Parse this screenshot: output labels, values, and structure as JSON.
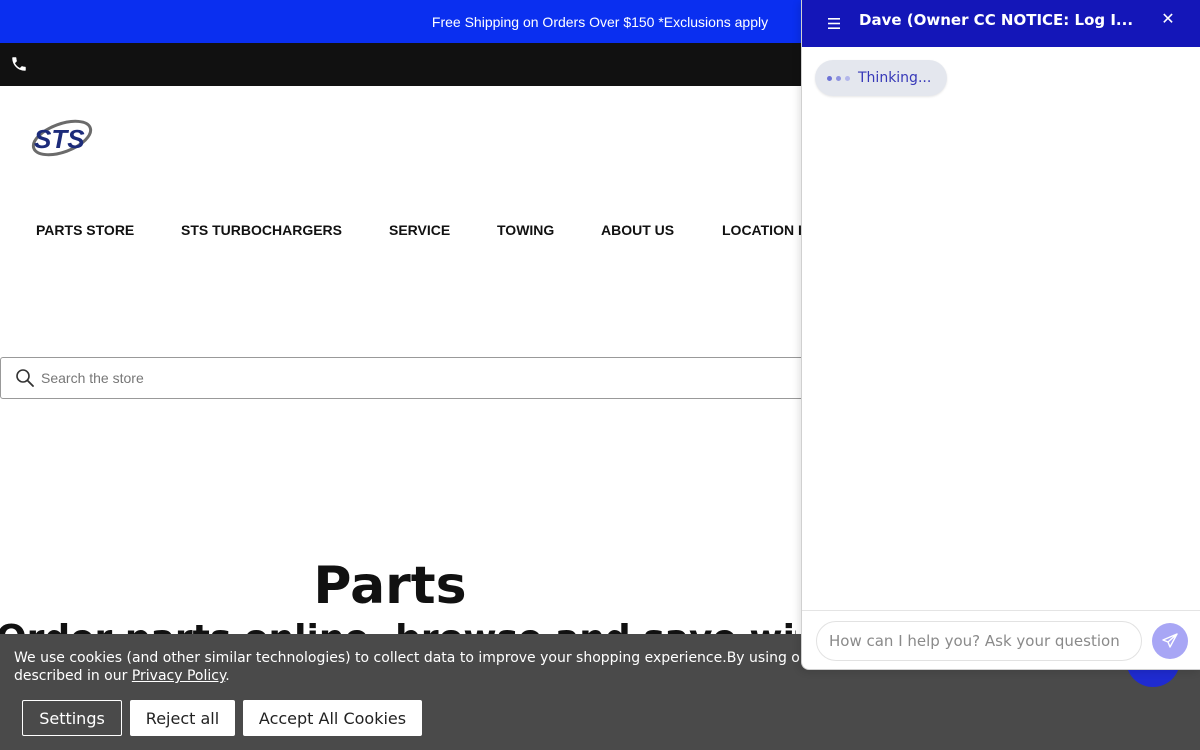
{
  "promo": {
    "text": "Free Shipping on Orders Over $150 *Exclusions apply"
  },
  "utility": {
    "phone_icon": "phone-icon"
  },
  "logo": {
    "text": "STS"
  },
  "nav": {
    "items": [
      {
        "label": "PARTS STORE"
      },
      {
        "label": "STS TURBOCHARGERS"
      },
      {
        "label": "SERVICE"
      },
      {
        "label": "TOWING"
      },
      {
        "label": "ABOUT US"
      },
      {
        "label": "LOCATION I"
      }
    ]
  },
  "search": {
    "placeholder": "Search the store",
    "icon": "search-icon"
  },
  "hero": {
    "title": "Parts",
    "subtitle": "Order parts online, browse and save with"
  },
  "cookie": {
    "text_prefix": "We use cookies (and other similar technologies) to collect data to improve your shopping experience.By using ou",
    "text_line2": "described in our ",
    "policy_link": "Privacy Policy",
    "text_suffix": ".",
    "settings_label": "Settings",
    "reject_label": "Reject all",
    "accept_label": "Accept All Cookies"
  },
  "chat": {
    "title": "Dave (Owner CC NOTICE: Log I...",
    "close_glyph": "✕",
    "thinking": "Thinking...",
    "input_placeholder": "How can I help you? Ask your question",
    "colors": {
      "header": "#1416b8",
      "send": "#a8a6f5",
      "launcher": "#1f2bd0"
    }
  }
}
